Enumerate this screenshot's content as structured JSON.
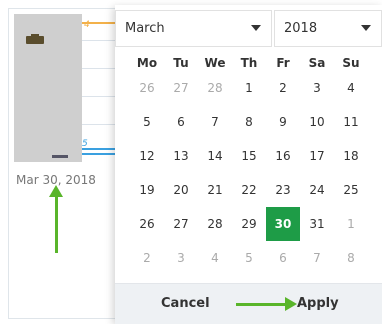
{
  "background": {
    "strip_top_number": "4",
    "strip_blue_number": "5",
    "date_label": "Mar 30, 2018"
  },
  "calendar": {
    "month_value": "March",
    "year_value": "2018",
    "weekdays": [
      "Mo",
      "Tu",
      "We",
      "Th",
      "Fr",
      "Sa",
      "Su"
    ],
    "weeks": [
      [
        {
          "d": "26",
          "m": true
        },
        {
          "d": "27",
          "m": true
        },
        {
          "d": "28",
          "m": true
        },
        {
          "d": "1"
        },
        {
          "d": "2"
        },
        {
          "d": "3"
        },
        {
          "d": "4"
        }
      ],
      [
        {
          "d": "5"
        },
        {
          "d": "6"
        },
        {
          "d": "7"
        },
        {
          "d": "8"
        },
        {
          "d": "9"
        },
        {
          "d": "10"
        },
        {
          "d": "11"
        }
      ],
      [
        {
          "d": "12"
        },
        {
          "d": "13"
        },
        {
          "d": "14"
        },
        {
          "d": "15"
        },
        {
          "d": "16"
        },
        {
          "d": "17"
        },
        {
          "d": "18"
        }
      ],
      [
        {
          "d": "19"
        },
        {
          "d": "20"
        },
        {
          "d": "21"
        },
        {
          "d": "22"
        },
        {
          "d": "23"
        },
        {
          "d": "24"
        },
        {
          "d": "25"
        }
      ],
      [
        {
          "d": "26"
        },
        {
          "d": "27"
        },
        {
          "d": "28"
        },
        {
          "d": "29"
        },
        {
          "d": "30",
          "s": true
        },
        {
          "d": "31"
        },
        {
          "d": "1",
          "m": true
        }
      ],
      [
        {
          "d": "2",
          "m": true
        },
        {
          "d": "3",
          "m": true
        },
        {
          "d": "4",
          "m": true
        },
        {
          "d": "5",
          "m": true
        },
        {
          "d": "6",
          "m": true
        },
        {
          "d": "7",
          "m": true
        },
        {
          "d": "8",
          "m": true
        }
      ]
    ],
    "cancel_label": "Cancel",
    "apply_label": "Apply"
  },
  "colors": {
    "selected_day": "#1e9c47",
    "annotation_arrow": "#59b52a"
  }
}
